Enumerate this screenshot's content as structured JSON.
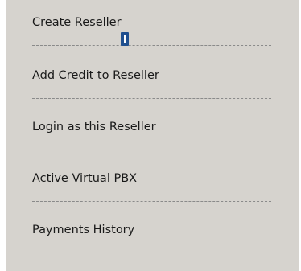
{
  "menu": {
    "items": [
      {
        "label": "Create Reseller"
      },
      {
        "label": "Add Credit to Reseller"
      },
      {
        "label": "Login as this Reseller"
      },
      {
        "label": "Active Virtual PBX"
      },
      {
        "label": "Payments History"
      }
    ]
  },
  "colors": {
    "panel_background": "#d6d3ce",
    "text": "#1a1a1a",
    "separator": "#8a8a8a",
    "cursor": "#1f4f8f"
  },
  "icons": {
    "cursor": "text-cursor-icon"
  }
}
